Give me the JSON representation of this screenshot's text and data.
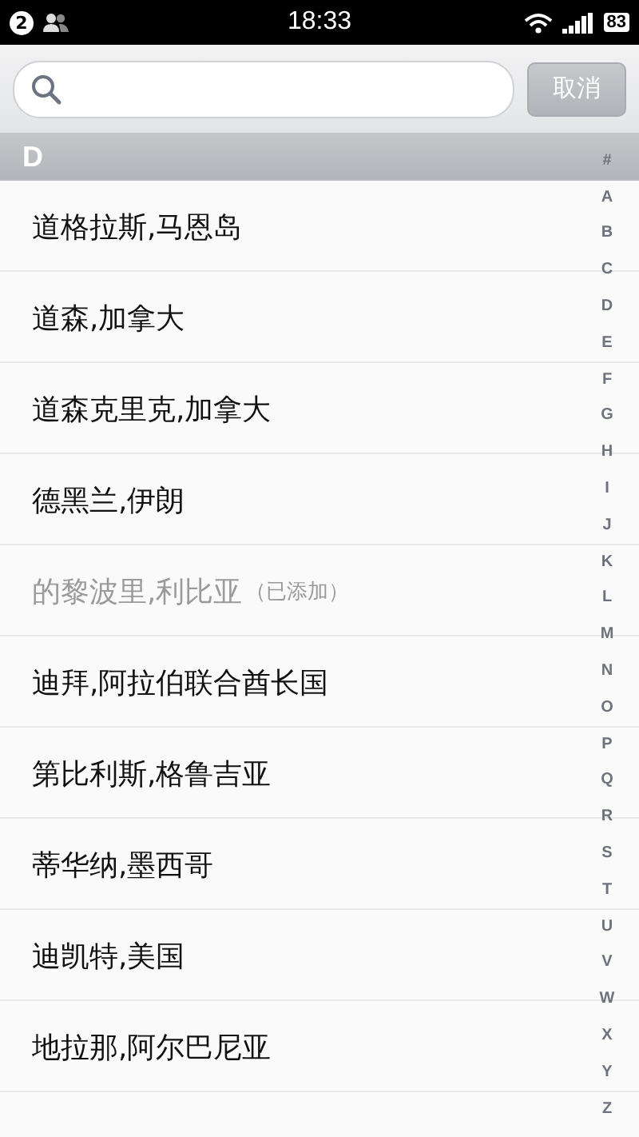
{
  "status_bar": {
    "notification_count": "2",
    "time": "18:33",
    "battery": "83"
  },
  "search": {
    "cancel_label": "取消"
  },
  "section": {
    "letter": "D"
  },
  "cities": [
    {
      "name": "道格拉斯,马恩岛",
      "added": false
    },
    {
      "name": "道森,加拿大",
      "added": false
    },
    {
      "name": "道森克里克,加拿大",
      "added": false
    },
    {
      "name": "德黑兰,伊朗",
      "added": false
    },
    {
      "name": "的黎波里,利比亚",
      "added": true,
      "note": "（已添加）"
    },
    {
      "name": "迪拜,阿拉伯联合酋长国",
      "added": false
    },
    {
      "name": "第比利斯,格鲁吉亚",
      "added": false
    },
    {
      "name": "蒂华纳,墨西哥",
      "added": false
    },
    {
      "name": "迪凯特,美国",
      "added": false
    },
    {
      "name": "地拉那,阿尔巴尼亚",
      "added": false
    }
  ],
  "index": [
    "#",
    "A",
    "B",
    "C",
    "D",
    "E",
    "F",
    "G",
    "H",
    "I",
    "J",
    "K",
    "L",
    "M",
    "N",
    "O",
    "P",
    "Q",
    "R",
    "S",
    "T",
    "U",
    "V",
    "W",
    "X",
    "Y",
    "Z"
  ]
}
